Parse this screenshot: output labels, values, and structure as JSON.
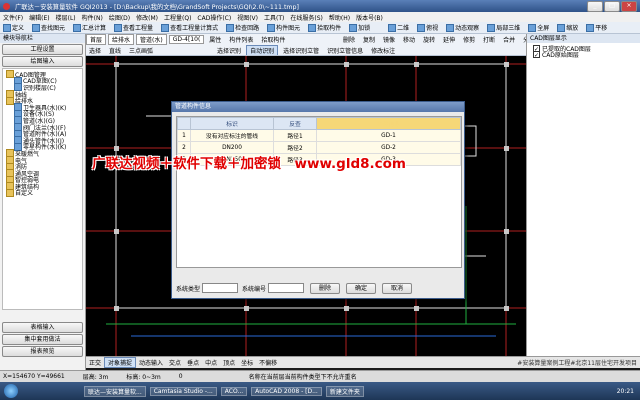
{
  "window": {
    "title": "广联达－安装算量软件 GQI2013 - [D:\\Backup\\我的文档\\GrandSoft Projects\\GQI\\2.0\\~111.tmp]"
  },
  "menu": [
    "文件(F)",
    "编辑(E)",
    "楼层(L)",
    "构件(N)",
    "绘图(D)",
    "修改(M)",
    "工程量(Q)",
    "CAD操作(C)",
    "视图(V)",
    "工具(T)",
    "在线服务(S)",
    "帮助(H)",
    "版本号(B)"
  ],
  "toolbar1": [
    "定义",
    "查找图元",
    "汇总计算",
    "查看工程量",
    "查看工程量计算式",
    "检查回路",
    "构件图元",
    "拾取构件",
    "加锁",
    "二维",
    "俯视",
    "动态观察",
    "局部三维",
    "全屏",
    "缩放",
    "平移"
  ],
  "toolbar2": [
    "首层",
    "给排水",
    "管道(水)",
    "GD-4[10(",
    "属性",
    "构件列表",
    "拾取构件"
  ],
  "toolbar3": [
    "选择",
    "直线",
    "三点画弧",
    "删除",
    "复制",
    "镜像",
    "移动",
    "旋转",
    "延伸",
    "修剪",
    "打断",
    "合并",
    "分割",
    "对齐",
    "偏移"
  ],
  "toolbar4": [
    "选择识别",
    "自动识别",
    "选择识别立管",
    "识别立管信息",
    "修改标注"
  ],
  "left_panel": {
    "header": "模块导航栏",
    "tabs": [
      "工程设置",
      "绘图输入"
    ],
    "tree": [
      "CAD图管理",
      "CAD草图(C)",
      "识别楼层(C)",
      "轴线",
      "给排水",
      "卫生器具(水)(K)",
      "设备(水)(S)",
      "管道(水)(G)",
      "阀门法兰(水)(F)",
      "管道附件(水)(A)",
      "通头管件(水)(J)",
      "零星构件(水)(K)",
      "采暖燃气",
      "电气",
      "消防",
      "通风空调",
      "智控弱电",
      "建筑结构",
      "自定义"
    ],
    "bottom": [
      "表格输入",
      "集中套用做法",
      "报表预览"
    ]
  },
  "right_panel": {
    "header": "CAD图层显示",
    "items": [
      "已提取的CAD图层",
      "CAD原始图层"
    ]
  },
  "dialog": {
    "title": "管道构件信息",
    "columns": [
      "",
      "标识",
      "反查",
      "构件信息"
    ],
    "rows": [
      [
        "1",
        "没有对应标注的管线",
        "路径1",
        "GD-1"
      ],
      [
        "2",
        "DN200",
        "路径2",
        "GD-2"
      ],
      [
        "3",
        "DN150",
        "路径3",
        "GD-3"
      ]
    ],
    "system_type_label": "系统类型",
    "system_no_label": "系统编号",
    "delete_button": "删除",
    "ok_button": "确定",
    "cancel_button": "取消"
  },
  "watermark": "广联达视频＋软件下载＋加密锁　www.gld8.com",
  "snapbar": [
    "正交",
    "对象捕捉",
    "动态输入",
    "交点",
    "垂点",
    "中点",
    "顶点",
    "坐标",
    "不偏移",
    "X=",
    "Y=",
    "旋转"
  ],
  "snapbar_note": "#安装算量案例工程#北京11层住宅开发项目",
  "statusbar": {
    "coords": "X=154670 Y=49661",
    "floor_height": "层高: 3m",
    "elevation": "标高: 0~3m",
    "count": "0",
    "message": "名称在当前层当前构件类型下不允许重名"
  },
  "taskbar": {
    "items": [
      "联达—安装算量软...",
      "Camtasia Studio -...",
      "ACO...",
      "AutoCAD 2008 - [D...",
      "新建文件夹"
    ],
    "clock": "20:21"
  },
  "colors": {
    "titlebar": "#3b5f93",
    "canvas": "#000000",
    "panel": "#f2f2f2",
    "accent_red": "#d00000"
  }
}
